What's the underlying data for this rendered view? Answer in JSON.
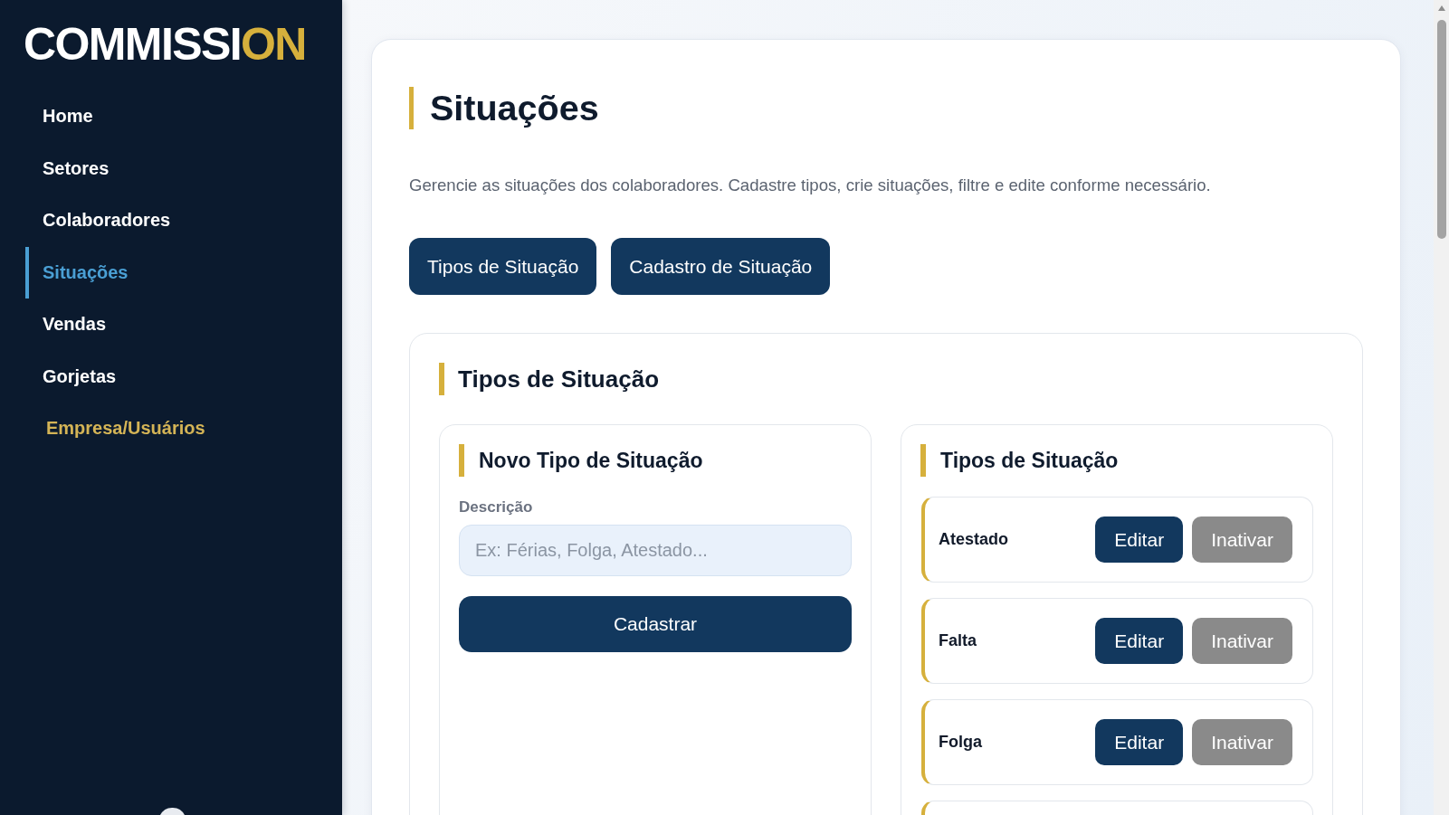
{
  "sidebar": {
    "logo": {
      "text": "COMMISSI",
      "accent_text": "ON"
    },
    "nav": [
      {
        "label": "Home",
        "selected": false,
        "kind": "page"
      },
      {
        "label": "Setores",
        "selected": false,
        "kind": "page"
      },
      {
        "label": "Colaboradores",
        "selected": false,
        "kind": "page"
      },
      {
        "label": "Situações",
        "selected": true,
        "kind": "page"
      },
      {
        "label": "Vendas",
        "selected": false,
        "kind": "page"
      },
      {
        "label": "Gorjetas",
        "selected": false,
        "kind": "page"
      },
      {
        "label": "Empresa/Usuários",
        "selected": false,
        "kind": "admin"
      }
    ]
  },
  "page": {
    "title": "Situações",
    "description": "Gerencie as situações dos colaboradores. Cadastre tipos, crie situações, filtre e edite conforme necessário.",
    "view_buttons": [
      "Tipos de Situação",
      "Cadastro de Situação"
    ]
  },
  "section": {
    "title": "Tipos de Situação",
    "form": {
      "title": "Novo Tipo de Situação",
      "field_label": "Descrição",
      "placeholder": "Ex: Férias, Folga, Atestado...",
      "submit": "Cadastrar"
    },
    "list": {
      "title": "Tipos de Situação",
      "items": [
        {
          "name": "Atestado",
          "actions": [
            {
              "label": "Editar",
              "kind": "primary"
            },
            {
              "label": "Inativar",
              "kind": "muted"
            }
          ]
        },
        {
          "name": "Falta",
          "actions": [
            {
              "label": "Editar",
              "kind": "primary"
            },
            {
              "label": "Inativar",
              "kind": "muted"
            }
          ]
        },
        {
          "name": "Folga",
          "actions": [
            {
              "label": "Editar",
              "kind": "primary"
            },
            {
              "label": "Inativar",
              "kind": "muted"
            }
          ]
        }
      ],
      "more_below": true
    }
  }
}
